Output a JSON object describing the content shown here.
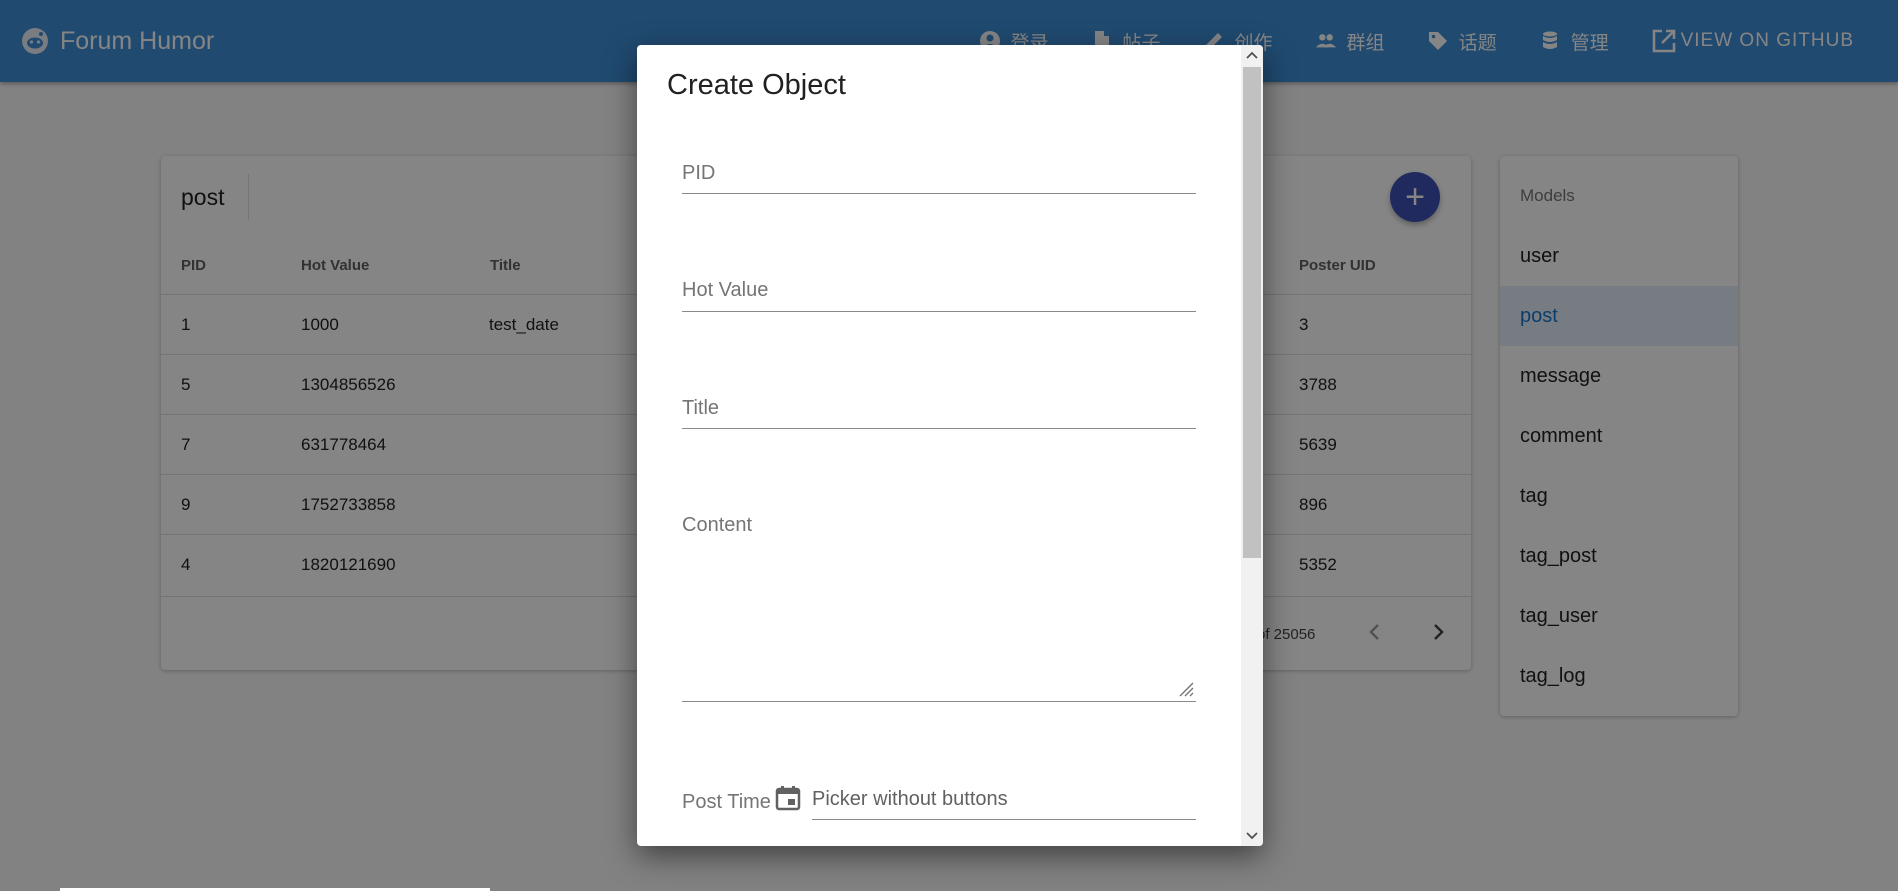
{
  "app": {
    "title": "Forum Humor",
    "nav": [
      {
        "label": "登录",
        "icon": "account-circle-icon"
      },
      {
        "label": "帖子",
        "icon": "document-icon"
      },
      {
        "label": "创作",
        "icon": "pencil-icon"
      },
      {
        "label": "群组",
        "icon": "group-icon"
      },
      {
        "label": "话题",
        "icon": "tag-icon"
      },
      {
        "label": "管理",
        "icon": "database-icon"
      }
    ],
    "github_label": "VIEW ON GITHUB"
  },
  "colors": {
    "appbar": "#3f8fd6",
    "fab": "#3f51b5",
    "active_model": "#1976d2"
  },
  "table": {
    "name": "post",
    "columns": {
      "pid": "PID",
      "hot_value": "Hot Value",
      "title": "Title",
      "poster_uid": "Poster UID"
    },
    "rows": [
      {
        "pid": "1",
        "hot_value": "1000",
        "title": "test_date",
        "poster_uid": "3"
      },
      {
        "pid": "5",
        "hot_value": "1304856526",
        "title": "",
        "poster_uid": "3788"
      },
      {
        "pid": "7",
        "hot_value": "631778464",
        "title": "",
        "poster_uid": "5639"
      },
      {
        "pid": "9",
        "hot_value": "1752733858",
        "title": "",
        "poster_uid": "896"
      },
      {
        "pid": "4",
        "hot_value": "1820121690",
        "title": "",
        "poster_uid": "5352"
      }
    ],
    "pagination_text": "of 25056"
  },
  "models": {
    "heading": "Models",
    "items": [
      "user",
      "post",
      "message",
      "comment",
      "tag",
      "tag_post",
      "tag_user",
      "tag_log"
    ],
    "active": "post"
  },
  "dialog": {
    "title": "Create Object",
    "fields": {
      "pid": "PID",
      "hot_value": "Hot Value",
      "title": "Title",
      "content": "Content",
      "post_time": "Post Time",
      "picker_placeholder": "Picker without buttons"
    }
  }
}
